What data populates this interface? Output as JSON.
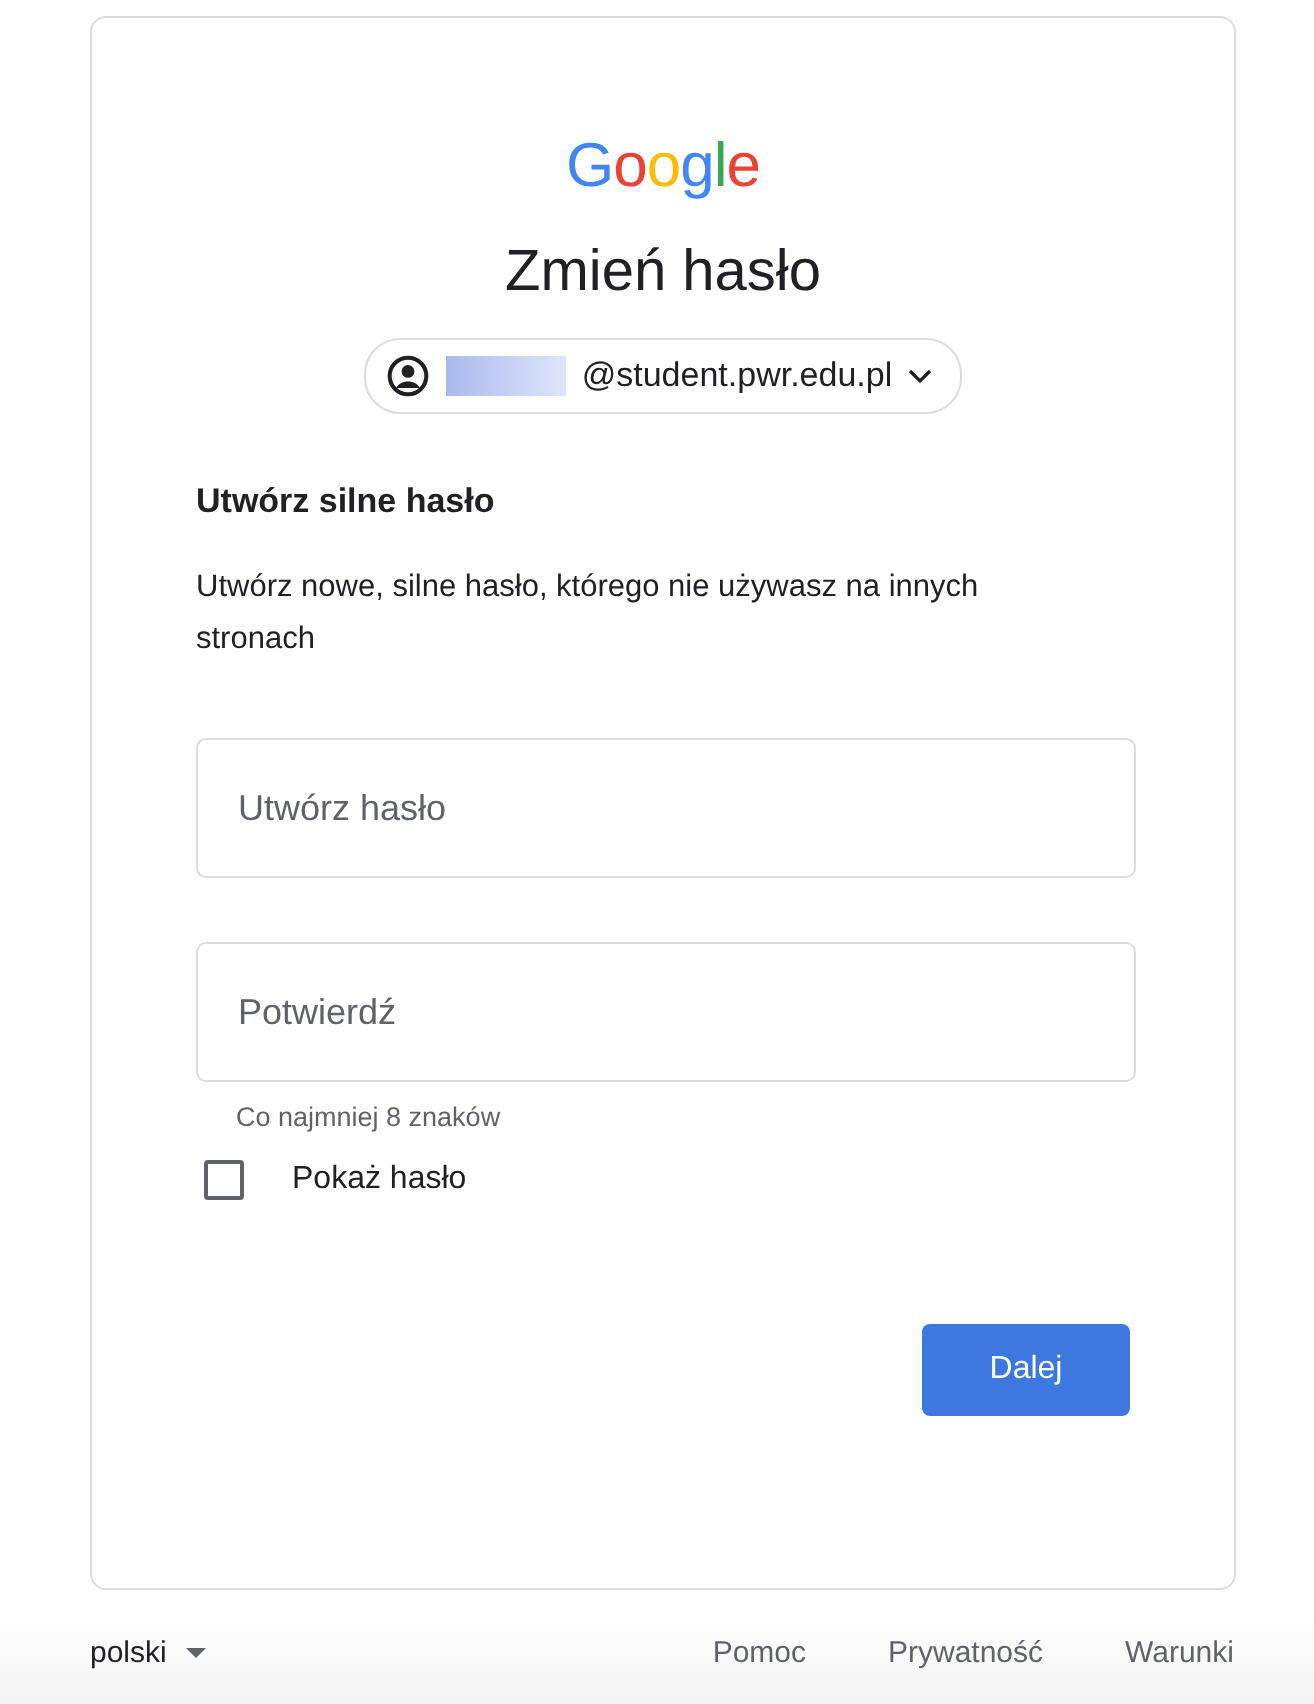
{
  "logo": "Google",
  "title": "Zmień hasło",
  "account": {
    "email": "@student.pwr.edu.pl",
    "redacted": true
  },
  "heading": "Utwórz silne hasło",
  "description": "Utwórz nowe, silne hasło, którego nie używasz na innych stronach",
  "fields": [
    {
      "placeholder": "Utwórz hasło"
    },
    {
      "placeholder": "Potwierdź"
    }
  ],
  "hint": "Co najmniej 8 znaków",
  "show_password": {
    "label": "Pokaż hasło",
    "checked": false
  },
  "next_button": "Dalej",
  "footer": {
    "language": "polski",
    "links": [
      "Pomoc",
      "Prywatność",
      "Warunki"
    ]
  }
}
